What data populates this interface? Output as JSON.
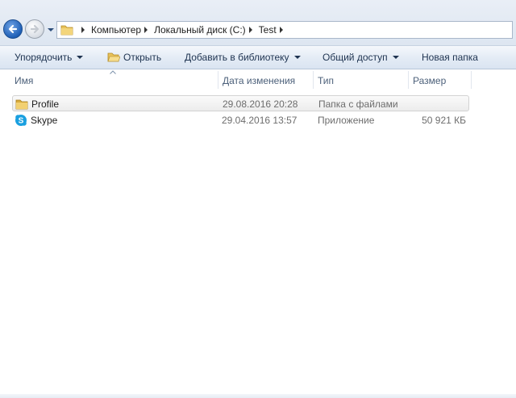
{
  "address_bar": {
    "breadcrumbs": [
      "Компьютер",
      "Локальный диск (C:)",
      "Test"
    ]
  },
  "toolbar": {
    "organize_label": "Упорядочить",
    "open_label": "Открыть",
    "add_to_library_label": "Добавить в библиотеку",
    "share_label": "Общий доступ",
    "new_folder_label": "Новая папка"
  },
  "columns": {
    "name": "Имя",
    "date": "Дата изменения",
    "type": "Тип",
    "size": "Размер"
  },
  "files": [
    {
      "name": "Profile",
      "date": "29.08.2016 20:28",
      "type": "Папка с файлами",
      "size": "",
      "icon": "folder-icon",
      "selected": true
    },
    {
      "name": "Skype",
      "date": "29.04.2016 13:57",
      "type": "Приложение",
      "size": "50 921 КБ",
      "icon": "skype-icon",
      "selected": false
    }
  ],
  "colors": {
    "accent": "#1f5fb6",
    "folder": "#e8c25a",
    "skype": "#1aa0e0"
  }
}
